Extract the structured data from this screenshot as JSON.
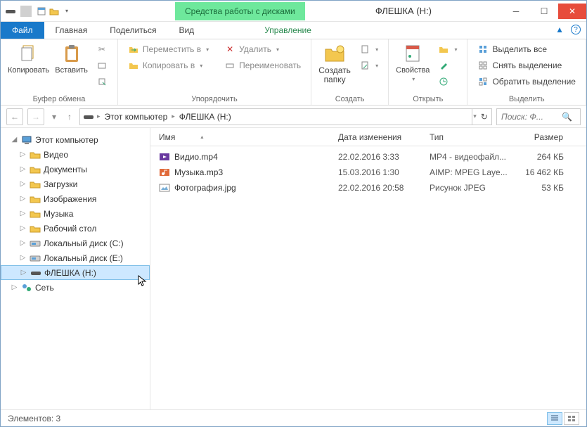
{
  "window": {
    "title": "ФЛЕШКА (H:)",
    "context_tab": "Средства работы с дисками"
  },
  "tabs": {
    "file": "Файл",
    "home": "Главная",
    "share": "Поделиться",
    "view": "Вид",
    "manage": "Управление"
  },
  "ribbon": {
    "clipboard": {
      "copy": "Копировать",
      "paste": "Вставить",
      "label": "Буфер обмена"
    },
    "organize": {
      "move_to": "Переместить в",
      "copy_to": "Копировать в",
      "delete": "Удалить",
      "rename": "Переименовать",
      "label": "Упорядочить"
    },
    "new": {
      "folder_l1": "Создать",
      "folder_l2": "папку",
      "label": "Создать"
    },
    "open": {
      "props": "Свойства",
      "label": "Открыть"
    },
    "select": {
      "all": "Выделить все",
      "none": "Снять выделение",
      "invert": "Обратить выделение",
      "label": "Выделить"
    }
  },
  "breadcrumb": {
    "root": "Этот компьютер",
    "current": "ФЛЕШКА (H:)"
  },
  "search": {
    "placeholder": "Поиск: Ф..."
  },
  "columns": {
    "name": "Имя",
    "date": "Дата изменения",
    "type": "Тип",
    "size": "Размер"
  },
  "tree": {
    "this_pc": "Этот компьютер",
    "items": [
      {
        "label": "Видео",
        "icon": "folder"
      },
      {
        "label": "Документы",
        "icon": "folder"
      },
      {
        "label": "Загрузки",
        "icon": "folder"
      },
      {
        "label": "Изображения",
        "icon": "folder"
      },
      {
        "label": "Музыка",
        "icon": "folder"
      },
      {
        "label": "Рабочий стол",
        "icon": "folder"
      },
      {
        "label": "Локальный диск (C:)",
        "icon": "hdd"
      },
      {
        "label": "Локальный диск (E:)",
        "icon": "hdd"
      },
      {
        "label": "ФЛЕШКА (H:)",
        "icon": "usb",
        "selected": true
      }
    ],
    "network": "Сеть"
  },
  "files": [
    {
      "name": "Видио.mp4",
      "date": "22.02.2016 3:33",
      "type": "MP4 - видеофайл...",
      "size": "264 КБ",
      "icon": "video"
    },
    {
      "name": "Музыка.mp3",
      "date": "15.03.2016 1:30",
      "type": "AIMP: MPEG Laye...",
      "size": "16 462 КБ",
      "icon": "audio"
    },
    {
      "name": "Фотография.jpg",
      "date": "22.02.2016 20:58",
      "type": "Рисунок JPEG",
      "size": "53 КБ",
      "icon": "image"
    }
  ],
  "status": {
    "count_label": "Элементов:",
    "count": "3"
  }
}
